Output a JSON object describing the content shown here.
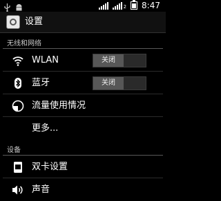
{
  "statusbar": {
    "time": "8:47",
    "sim2_label": "2"
  },
  "header": {
    "title": "设置"
  },
  "sections": {
    "wireless": "无线和网络",
    "device": "设备"
  },
  "rows": {
    "wlan": {
      "label": "WLAN",
      "toggle": "关闭"
    },
    "bluetooth": {
      "label": "蓝牙",
      "toggle": "关闭"
    },
    "data_usage": {
      "label": "流量使用情况"
    },
    "more": {
      "label": "更多..."
    },
    "dual_sim": {
      "label": "双卡设置"
    },
    "sound": {
      "label": "声音"
    }
  },
  "icons": [
    "usb-icon",
    "android-debug-icon",
    "signal-icon",
    "sim2-signal-icon",
    "battery-icon",
    "settings-app-icon",
    "wifi-icon",
    "bluetooth-icon",
    "data-usage-icon",
    "dual-sim-icon",
    "sound-icon"
  ]
}
